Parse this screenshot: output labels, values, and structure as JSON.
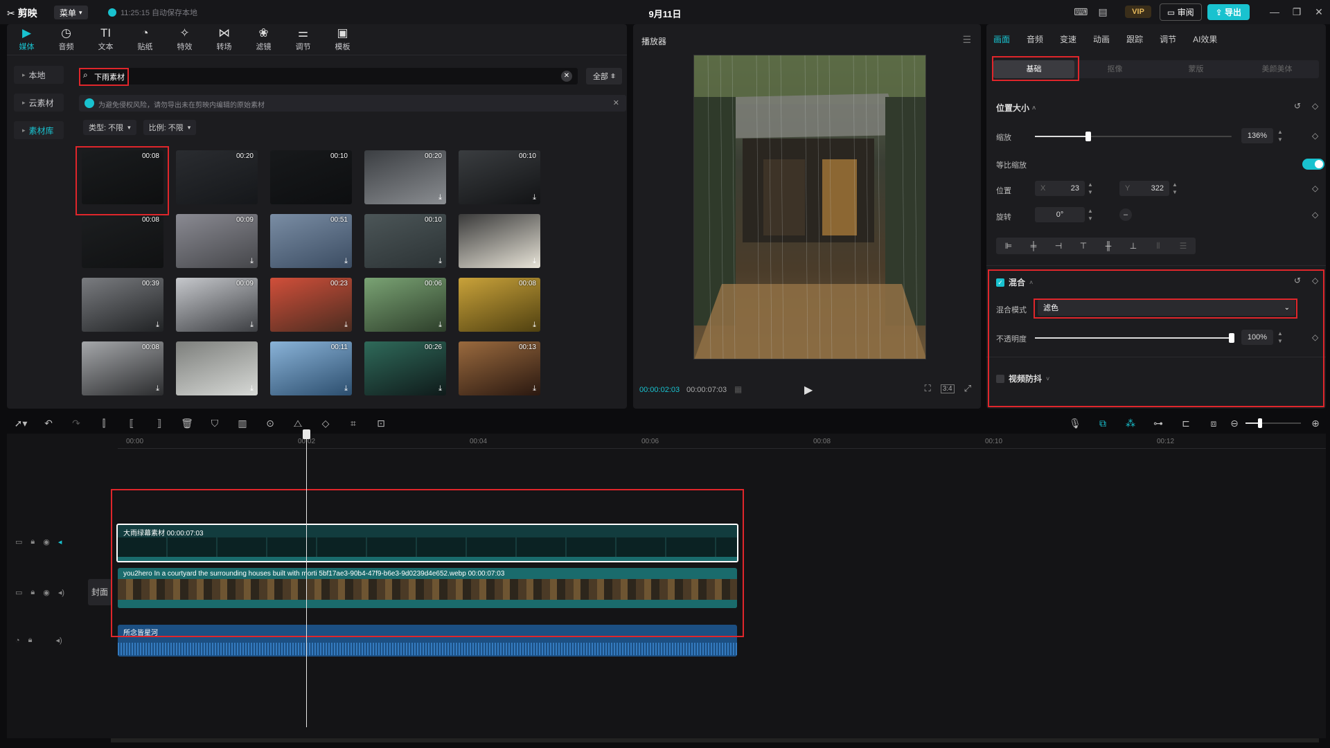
{
  "titlebar": {
    "logo": "剪映",
    "menu": "菜单",
    "save_status": "11:25:15 自动保存本地",
    "doc_title": "9月11日",
    "vip": "VIP",
    "review": "审阅",
    "export": "导出"
  },
  "media": {
    "tools": [
      {
        "label": "媒体",
        "icon": "▶"
      },
      {
        "label": "音频",
        "icon": "◷"
      },
      {
        "label": "文本",
        "icon": "TI"
      },
      {
        "label": "贴纸",
        "icon": "◔"
      },
      {
        "label": "特效",
        "icon": "✧"
      },
      {
        "label": "转场",
        "icon": "⋈"
      },
      {
        "label": "滤镜",
        "icon": "❀"
      },
      {
        "label": "调节",
        "icon": "⚌"
      },
      {
        "label": "模板",
        "icon": "▣"
      }
    ],
    "side_nav": [
      "本地",
      "云素材",
      "素材库"
    ],
    "search_value": "下雨素材",
    "filter_all": "全部",
    "notice": "为避免侵权风险，请勿导出未在剪映内编辑的原始素材",
    "filter_type": "类型: 不限",
    "filter_ratio": "比例: 不限",
    "clips": [
      {
        "dur": "00:08",
        "dl": ""
      },
      {
        "dur": "00:20",
        "dl": ""
      },
      {
        "dur": "00:10",
        "dl": ""
      },
      {
        "dur": "00:20",
        "dl": "⤓"
      },
      {
        "dur": "00:10",
        "dl": "⤓"
      },
      {
        "dur": "00:08",
        "dl": ""
      },
      {
        "dur": "00:09",
        "dl": "⤓"
      },
      {
        "dur": "00:51",
        "dl": "⤓"
      },
      {
        "dur": "00:10",
        "dl": "⤓"
      },
      {
        "dur": "",
        "dl": "⤓"
      },
      {
        "dur": "00:39",
        "dl": "⤓"
      },
      {
        "dur": "00:09",
        "dl": "⤓"
      },
      {
        "dur": "00:23",
        "dl": "⤓"
      },
      {
        "dur": "00:06",
        "dl": "⤓"
      },
      {
        "dur": "00:08",
        "dl": "⤓"
      },
      {
        "dur": "00:08",
        "dl": "⤓"
      },
      {
        "dur": "",
        "dl": "⤓"
      },
      {
        "dur": "00:11",
        "dl": "⤓"
      },
      {
        "dur": "00:26",
        "dl": "⤓"
      },
      {
        "dur": "00:13",
        "dl": "⤓"
      }
    ]
  },
  "player": {
    "title": "播放器",
    "current_time": "00:00:02:03",
    "total_time": "00:00:07:03",
    "ratio": "3:4"
  },
  "inspector": {
    "tabs": [
      "画面",
      "音频",
      "变速",
      "动画",
      "跟踪",
      "调节",
      "AI效果"
    ],
    "sub_tabs": [
      "基础",
      "抠像",
      "蒙版",
      "美颜美体"
    ],
    "position_size": "位置大小",
    "scale_label": "缩放",
    "scale_value": "136%",
    "scale_level": 0.27,
    "uniform_scale": "等比缩放",
    "position_label": "位置",
    "pos_x_label": "X",
    "pos_x": "23",
    "pos_y_label": "Y",
    "pos_y": "322",
    "rotation_label": "旋转",
    "rotation": "0°",
    "blend_section": "混合",
    "blend_mode_label": "混合模式",
    "blend_mode": "滤色",
    "opacity_label": "不透明度",
    "opacity_value": "100%",
    "opacity_level": 1.0,
    "stabilize": "视频防抖"
  },
  "timeline": {
    "ticks": [
      "00:00",
      "00:02",
      "00:04",
      "00:06",
      "00:08",
      "00:10",
      "00:12"
    ],
    "cover_label": "封面",
    "clip1_label": "大雨绿幕素材  00:00:07:03",
    "clip2_label": "you2hero In a courtyard the surrounding houses built with morti 5bf17ae3-90b4-47f9-b6e3-9d0239d4e652.webp  00:00:07:03",
    "clip3_label": "所念皆星河"
  },
  "colors": {
    "accent": "#19c2cf",
    "highlight": "#e0262b",
    "clip_teal": "#1a6b6c",
    "clip_audio": "#1c4f82"
  }
}
